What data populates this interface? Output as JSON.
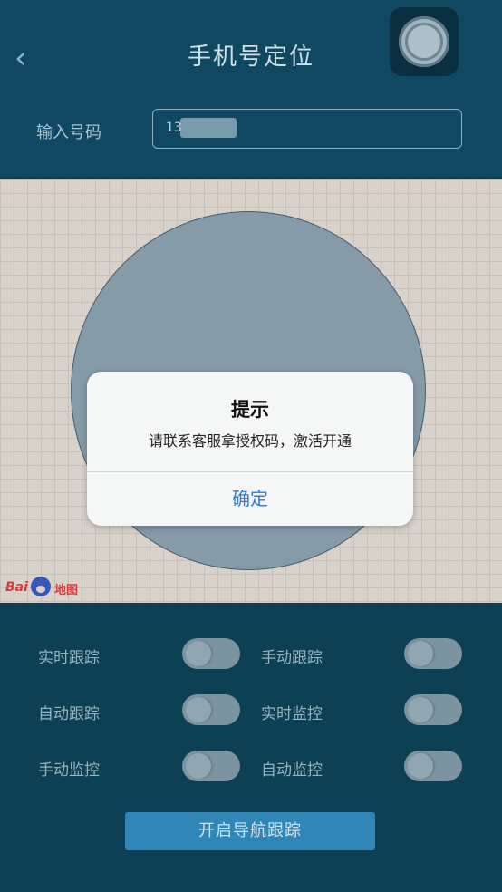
{
  "header": {
    "title": "手机号定位",
    "back_icon": "chevron-left-icon"
  },
  "phone": {
    "label": "输入号码",
    "value": "13"
  },
  "map": {
    "logo_text_1": "Bai",
    "logo_text_2": "地图"
  },
  "dialog": {
    "title": "提示",
    "message": "请联系客服拿授权码，激活开通",
    "confirm_label": "确定"
  },
  "controls": [
    {
      "label": "实时跟踪",
      "on": false
    },
    {
      "label": "手动跟踪",
      "on": false
    },
    {
      "label": "自动跟踪",
      "on": false
    },
    {
      "label": "实时监控",
      "on": false
    },
    {
      "label": "手动监控",
      "on": false
    },
    {
      "label": "自动监控",
      "on": false
    }
  ],
  "nav_button": {
    "label": "开启导航跟踪"
  },
  "colors": {
    "background": "#0d3f55",
    "header": "#0f4860",
    "accent": "#2f86b7",
    "dialog_button": "#2a7de0"
  }
}
